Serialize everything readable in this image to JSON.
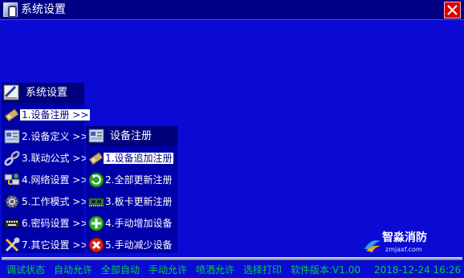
{
  "window": {
    "title": "系统设置",
    "icon": "app-icon"
  },
  "main_menu": {
    "title": "系统设置",
    "items": [
      {
        "label": "1.设备注册 >>",
        "icon": "wrench-card-icon",
        "selected": true
      },
      {
        "label": "2.设备定义 >>",
        "icon": "config-panel-icon"
      },
      {
        "label": "3.联动公式 >>",
        "icon": "link-chain-icon"
      },
      {
        "label": "4.网络设置 >>",
        "icon": "network-icon"
      },
      {
        "label": "5.工作模式 >>",
        "icon": "gear-icon"
      },
      {
        "label": "6.密码设置 >>",
        "icon": "keyboard-icon"
      },
      {
        "label": "7.其它设置 >>",
        "icon": "tools-icon"
      }
    ]
  },
  "sub_menu": {
    "title": "设备注册",
    "items": [
      {
        "label": "1.设备追加注册",
        "icon": "wrench-card-icon",
        "selected": true
      },
      {
        "label": "2.全部更新注册",
        "icon": "refresh-icon"
      },
      {
        "label": "3.板卡更新注册",
        "icon": "circuit-board-icon"
      },
      {
        "label": "4.手动增加设备",
        "icon": "add-icon"
      },
      {
        "label": "5.手动减少设备",
        "icon": "remove-icon"
      }
    ]
  },
  "status_bar": {
    "items": [
      "调试状态",
      "自动允许",
      "全部自动",
      "手动允许",
      "喷洒允许",
      "选择打印"
    ],
    "version": "软件版本:V1.00",
    "datetime": "2018-12-24 16:26"
  },
  "watermark": {
    "name": "智淼消防",
    "url": "zmjaxf.com"
  },
  "colors": {
    "background": "#0a0ad4",
    "title_bar": "#000086",
    "menu": "#0000a8",
    "menu_header": "#00007a",
    "status_text": "#00d040",
    "close_button": "#e00000"
  }
}
